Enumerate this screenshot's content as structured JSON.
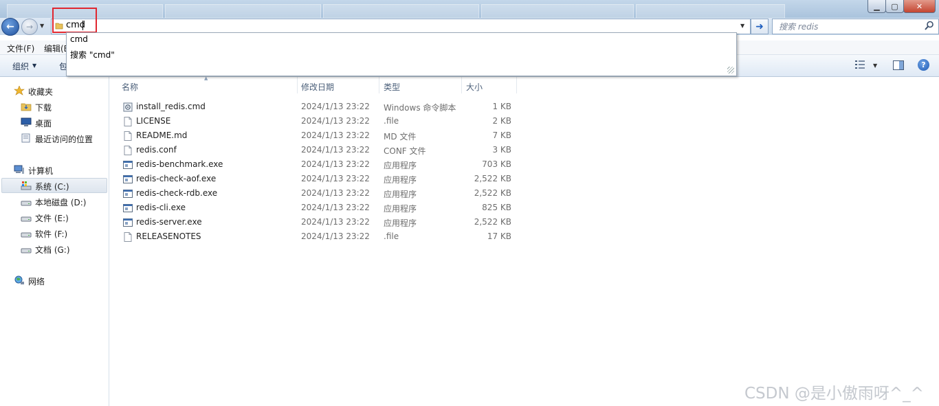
{
  "window": {
    "minimize_glyph": "▁",
    "maximize_glyph": "▢",
    "close_glyph": "✕"
  },
  "address": {
    "value": "cmd",
    "search_placeholder": "搜索 redis"
  },
  "autocomplete": {
    "items": [
      "cmd",
      "搜索 \"cmd\""
    ]
  },
  "menu": {
    "items": [
      "文件(F)",
      "编辑(E"
    ]
  },
  "toolbar": {
    "organize": "组织",
    "include": "包"
  },
  "nav": {
    "favorites": "收藏夹",
    "downloads": "下载",
    "desktop": "桌面",
    "recent": "最近访问的位置",
    "computer": "计算机",
    "drives": [
      "系统 (C:)",
      "本地磁盘 (D:)",
      "文件 (E:)",
      "软件 (F:)",
      "文档 (G:)"
    ],
    "network": "网络"
  },
  "columns": [
    "名称",
    "修改日期",
    "类型",
    "大小"
  ],
  "files": [
    {
      "name": "install_redis.cmd",
      "date": "2024/1/13 23:22",
      "type": "Windows 命令脚本",
      "size": "1 KB",
      "icon": "cmd-script-icon"
    },
    {
      "name": "LICENSE",
      "date": "2024/1/13 23:22",
      "type": ".file",
      "size": "2 KB",
      "icon": "file-icon"
    },
    {
      "name": "README.md",
      "date": "2024/1/13 23:22",
      "type": "MD 文件",
      "size": "7 KB",
      "icon": "file-icon"
    },
    {
      "name": "redis.conf",
      "date": "2024/1/13 23:22",
      "type": "CONF 文件",
      "size": "3 KB",
      "icon": "file-icon"
    },
    {
      "name": "redis-benchmark.exe",
      "date": "2024/1/13 23:22",
      "type": "应用程序",
      "size": "703 KB",
      "icon": "exe-icon"
    },
    {
      "name": "redis-check-aof.exe",
      "date": "2024/1/13 23:22",
      "type": "应用程序",
      "size": "2,522 KB",
      "icon": "exe-icon"
    },
    {
      "name": "redis-check-rdb.exe",
      "date": "2024/1/13 23:22",
      "type": "应用程序",
      "size": "2,522 KB",
      "icon": "exe-icon"
    },
    {
      "name": "redis-cli.exe",
      "date": "2024/1/13 23:22",
      "type": "应用程序",
      "size": "825 KB",
      "icon": "exe-icon"
    },
    {
      "name": "redis-server.exe",
      "date": "2024/1/13 23:22",
      "type": "应用程序",
      "size": "2,522 KB",
      "icon": "exe-icon"
    },
    {
      "name": "RELEASENOTES",
      "date": "2024/1/13 23:22",
      "type": ".file",
      "size": "17 KB",
      "icon": "file-icon"
    }
  ],
  "watermark": "CSDN @是小傲雨呀^_^",
  "colors": {
    "highlight_box": "#e0262f",
    "selection": "#dde5ee"
  }
}
